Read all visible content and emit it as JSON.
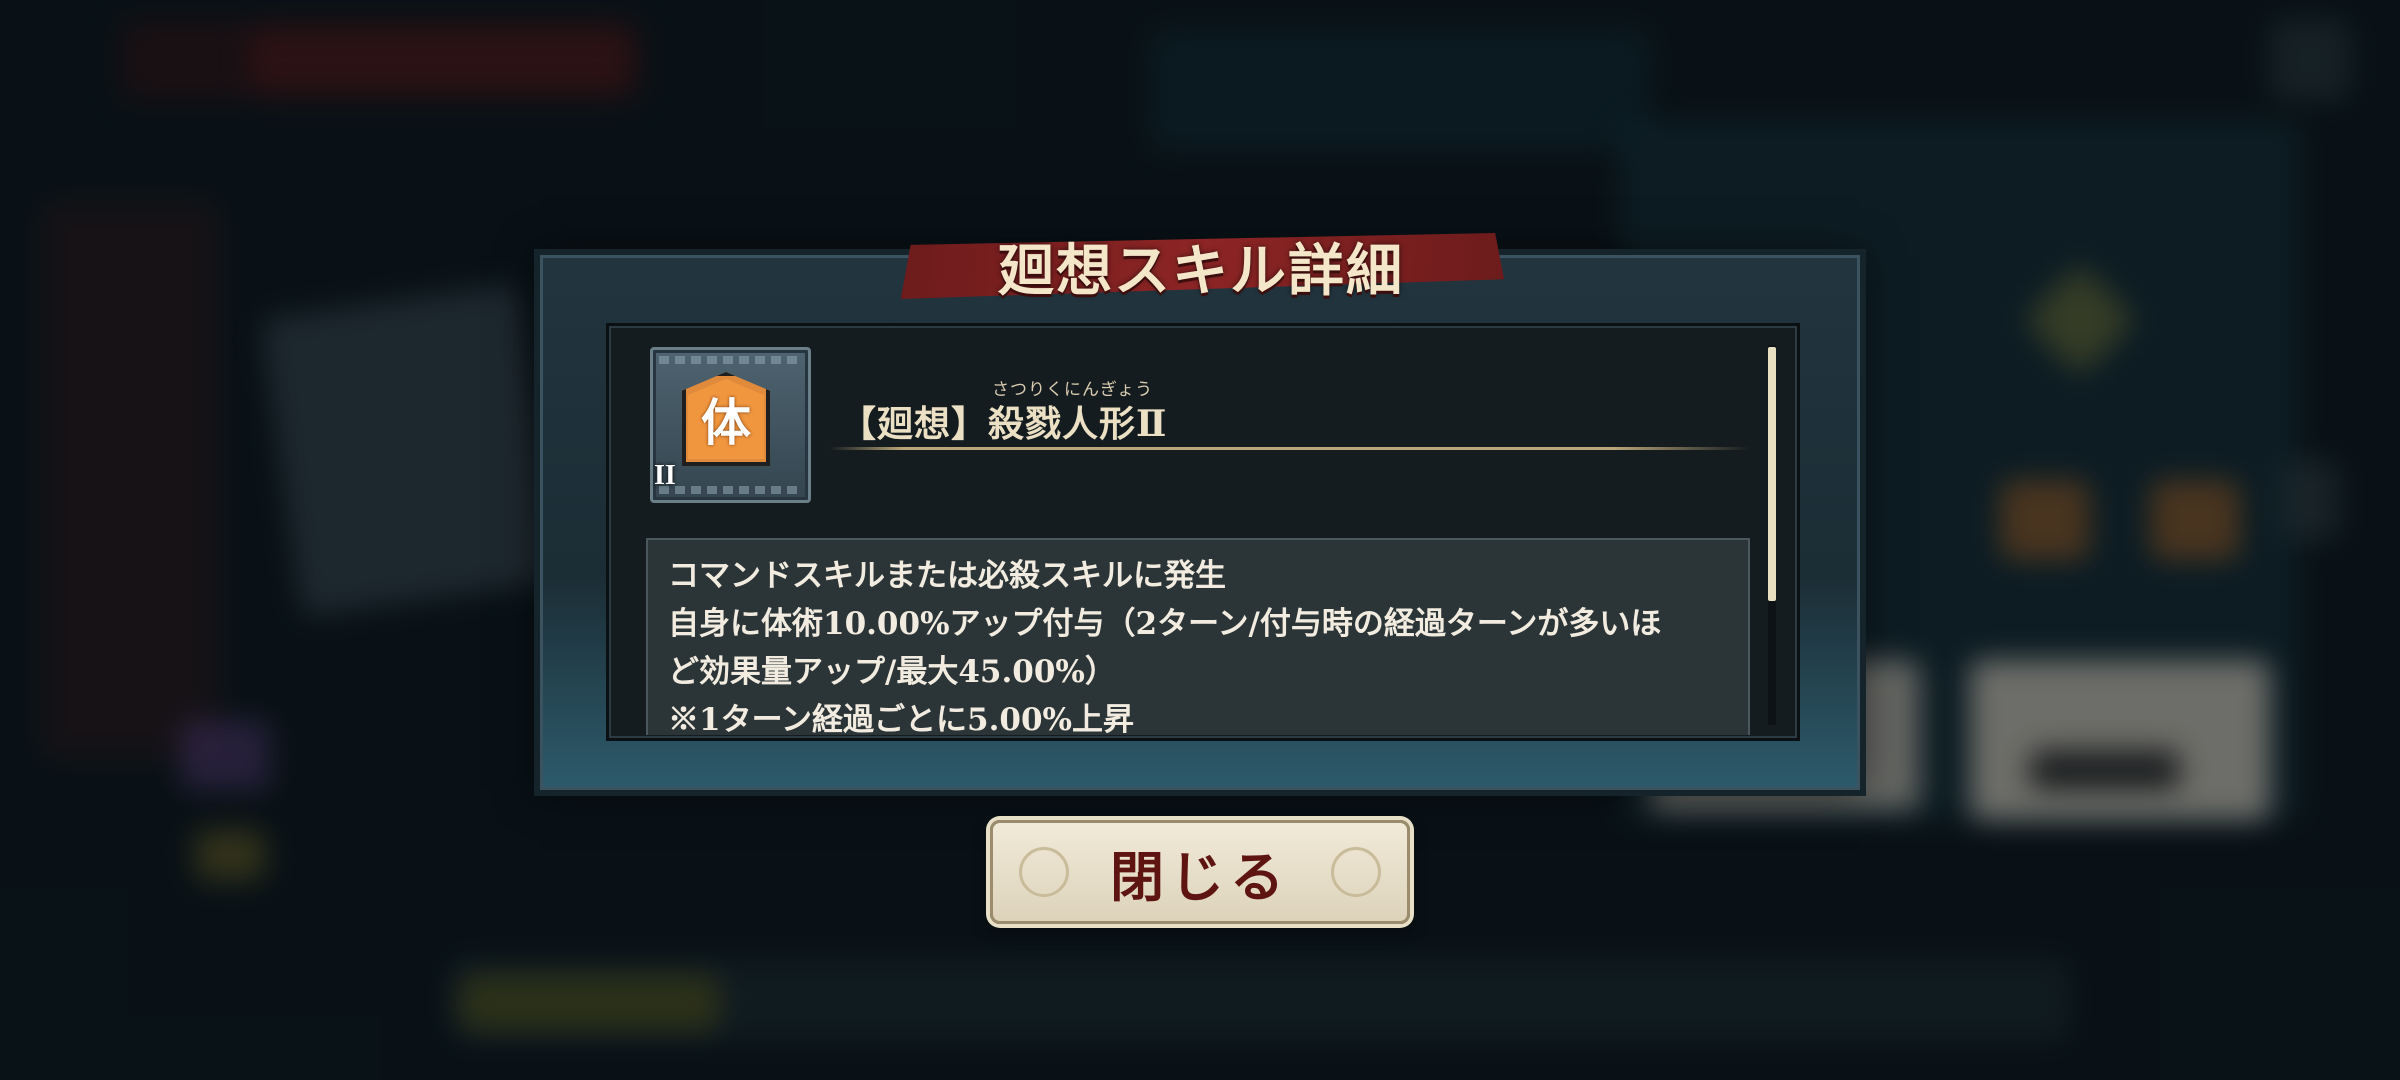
{
  "dialog": {
    "title": "廻想スキル詳細",
    "skill": {
      "icon_kanji": "体",
      "rank": "II",
      "ruby": "さつりくにんぎょう",
      "name": "【廻想】殺戮人形Ⅱ"
    },
    "description_lines": [
      "コマンドスキルまたは必殺スキルに発生",
      "自身に体術10.00%アップ付与（2ターン/付与時の経過ターンが多いほ",
      "ど効果量アップ/最大45.00%）",
      "※1ターン経過ごとに5.00%上昇"
    ],
    "close_label": "閉じる"
  },
  "icons": {
    "skill_icon": "martial-arts-skill-icon"
  },
  "colors": {
    "ribbon": "#8d2525",
    "badge": "#f0963f",
    "close_text": "#5e1512"
  }
}
